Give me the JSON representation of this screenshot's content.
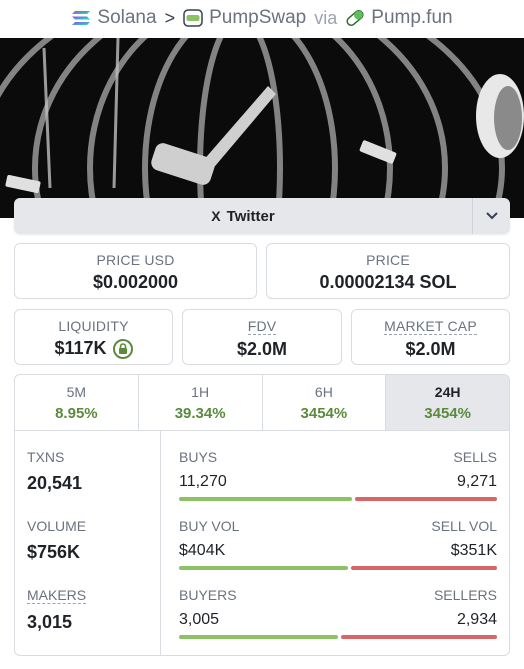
{
  "breadcrumb": {
    "chain": "Solana",
    "separator": ">",
    "dex": "PumpSwap",
    "via": "via",
    "launchpad": "Pump.fun"
  },
  "social": {
    "twitter_label": "Twitter",
    "x_glyph": "X"
  },
  "price_usd": {
    "label": "PRICE USD",
    "value": "$0.002000"
  },
  "price_native": {
    "label": "PRICE",
    "value": "0.00002134 SOL"
  },
  "liquidity": {
    "label": "LIQUIDITY",
    "value": "$117K",
    "icon": "lock-icon"
  },
  "fdv": {
    "label": "FDV",
    "value": "$2.0M"
  },
  "market_cap": {
    "label": "MARKET CAP",
    "value": "$2.0M"
  },
  "timeframes": [
    {
      "label": "5M",
      "change": "8.95%"
    },
    {
      "label": "1H",
      "change": "39.34%"
    },
    {
      "label": "6H",
      "change": "3454%"
    },
    {
      "label": "24H",
      "change": "3454%",
      "active": true
    }
  ],
  "stats": {
    "txns": {
      "label": "TXNS",
      "value": "20,541"
    },
    "volume": {
      "label": "VOLUME",
      "value": "$756K"
    },
    "makers": {
      "label": "MAKERS",
      "value": "3,015"
    }
  },
  "breakdown": {
    "buys": {
      "left_label": "BUYS",
      "right_label": "SELLS",
      "left_value": "11,270",
      "right_value": "9,271",
      "buy_share": 0.549
    },
    "vol": {
      "left_label": "BUY VOL",
      "right_label": "SELL VOL",
      "left_value": "$404K",
      "right_value": "$351K",
      "buy_share": 0.535
    },
    "buyers": {
      "left_label": "BUYERS",
      "right_label": "SELLERS",
      "left_value": "3,005",
      "right_value": "2,934",
      "buy_share": 0.506
    }
  },
  "colors": {
    "positive": "#5b8a3c",
    "buy_bar": "#8cc265",
    "sell_bar": "#d96666"
  }
}
